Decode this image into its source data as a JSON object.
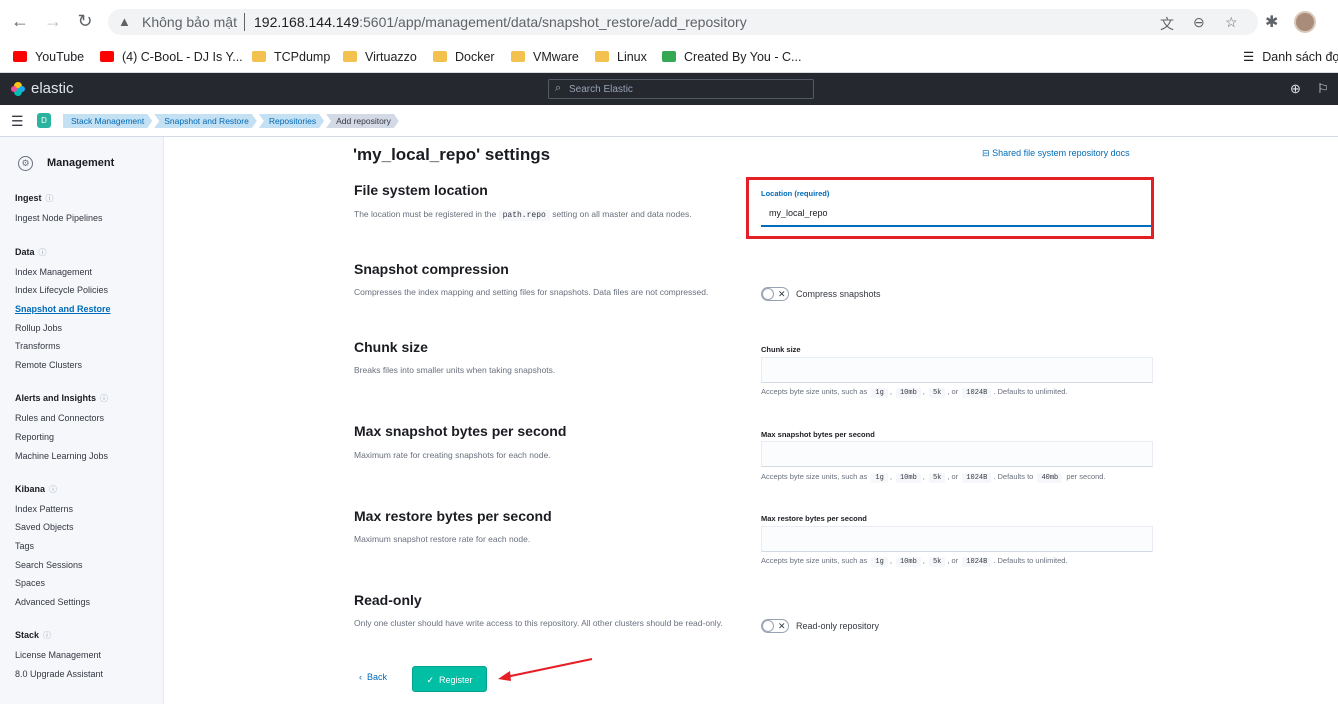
{
  "browser": {
    "insecure_label": "Không bảo mật",
    "url_host": "192.168.144.149",
    "url_rest": ":5601/app/management/data/snapshot_restore/add_repository",
    "bookmarks": [
      {
        "label": "YouTube",
        "icon": "youtube-icon"
      },
      {
        "label": "(4) C-BooL - DJ Is Y...",
        "icon": "youtube-icon"
      },
      {
        "label": "TCPdump",
        "icon": "folder-icon"
      },
      {
        "label": "Virtuazzo",
        "icon": "folder-icon"
      },
      {
        "label": "Docker",
        "icon": "folder-icon"
      },
      {
        "label": "VMware",
        "icon": "folder-icon"
      },
      {
        "label": "Linux",
        "icon": "folder-icon"
      },
      {
        "label": "Created By You - C...",
        "icon": "created-by-you-icon"
      }
    ],
    "reading_list": "Danh sách đọ"
  },
  "header": {
    "logo_text": "elastic",
    "search_placeholder": "Search Elastic"
  },
  "subheader": {
    "space_initial": "D",
    "breadcrumbs": [
      "Stack Management",
      "Snapshot and Restore",
      "Repositories",
      "Add repository"
    ]
  },
  "sidebar": {
    "title": "Management",
    "groups": [
      {
        "label": "Ingest",
        "items": [
          "Ingest Node Pipelines"
        ]
      },
      {
        "label": "Data",
        "items": [
          "Index Management",
          "Index Lifecycle Policies",
          "Snapshot and Restore",
          "Rollup Jobs",
          "Transforms",
          "Remote Clusters"
        ]
      },
      {
        "label": "Alerts and Insights",
        "items": [
          "Rules and Connectors",
          "Reporting",
          "Machine Learning Jobs"
        ]
      },
      {
        "label": "Kibana",
        "items": [
          "Index Patterns",
          "Saved Objects",
          "Tags",
          "Search Sessions",
          "Spaces",
          "Advanced Settings"
        ]
      },
      {
        "label": "Stack",
        "items": [
          "License Management",
          "8.0 Upgrade Assistant"
        ]
      }
    ],
    "active_item": "Snapshot and Restore"
  },
  "form": {
    "title": "'my_local_repo' settings",
    "docs_link": "Shared file system repository docs",
    "location": {
      "title": "File system location",
      "desc_before": "The location must be registered in the",
      "desc_code": "path.repo",
      "desc_after": "setting on all master and data nodes.",
      "label": "Location (required)",
      "value": "my_local_repo"
    },
    "compression": {
      "title": "Snapshot compression",
      "desc": "Compresses the index mapping and setting files for snapshots. Data files are not compressed.",
      "toggle_label": "Compress snapshots"
    },
    "chunk": {
      "title": "Chunk size",
      "desc": "Breaks files into smaller units when taking snapshots.",
      "label": "Chunk size",
      "help_prefix": "Accepts byte size units, such as",
      "help_suffix": ". Defaults to unlimited."
    },
    "max_snapshot": {
      "title": "Max snapshot bytes per second",
      "desc": "Maximum rate for creating snapshots for each node.",
      "label": "Max snapshot bytes per second",
      "help_prefix": "Accepts byte size units, such as",
      "help_mid": ". Defaults to",
      "help_default": "40mb",
      "help_suffix": "per second."
    },
    "max_restore": {
      "title": "Max restore bytes per second",
      "desc": "Maximum snapshot restore rate for each node.",
      "label": "Max restore bytes per second",
      "help_prefix": "Accepts byte size units, such as",
      "help_suffix": ". Defaults to unlimited."
    },
    "units": [
      "1g",
      "10mb",
      "5k",
      "1024B"
    ],
    "readonly": {
      "title": "Read-only",
      "desc": "Only one cluster should have write access to this repository. All other clusters should be read-only.",
      "toggle_label": "Read-only repository"
    },
    "back_label": "Back",
    "register_label": "Register"
  },
  "colors": {
    "accent": "#006bb8",
    "register": "#00bfa5",
    "highlight": "#e51f26",
    "header_bg": "#25282f"
  }
}
